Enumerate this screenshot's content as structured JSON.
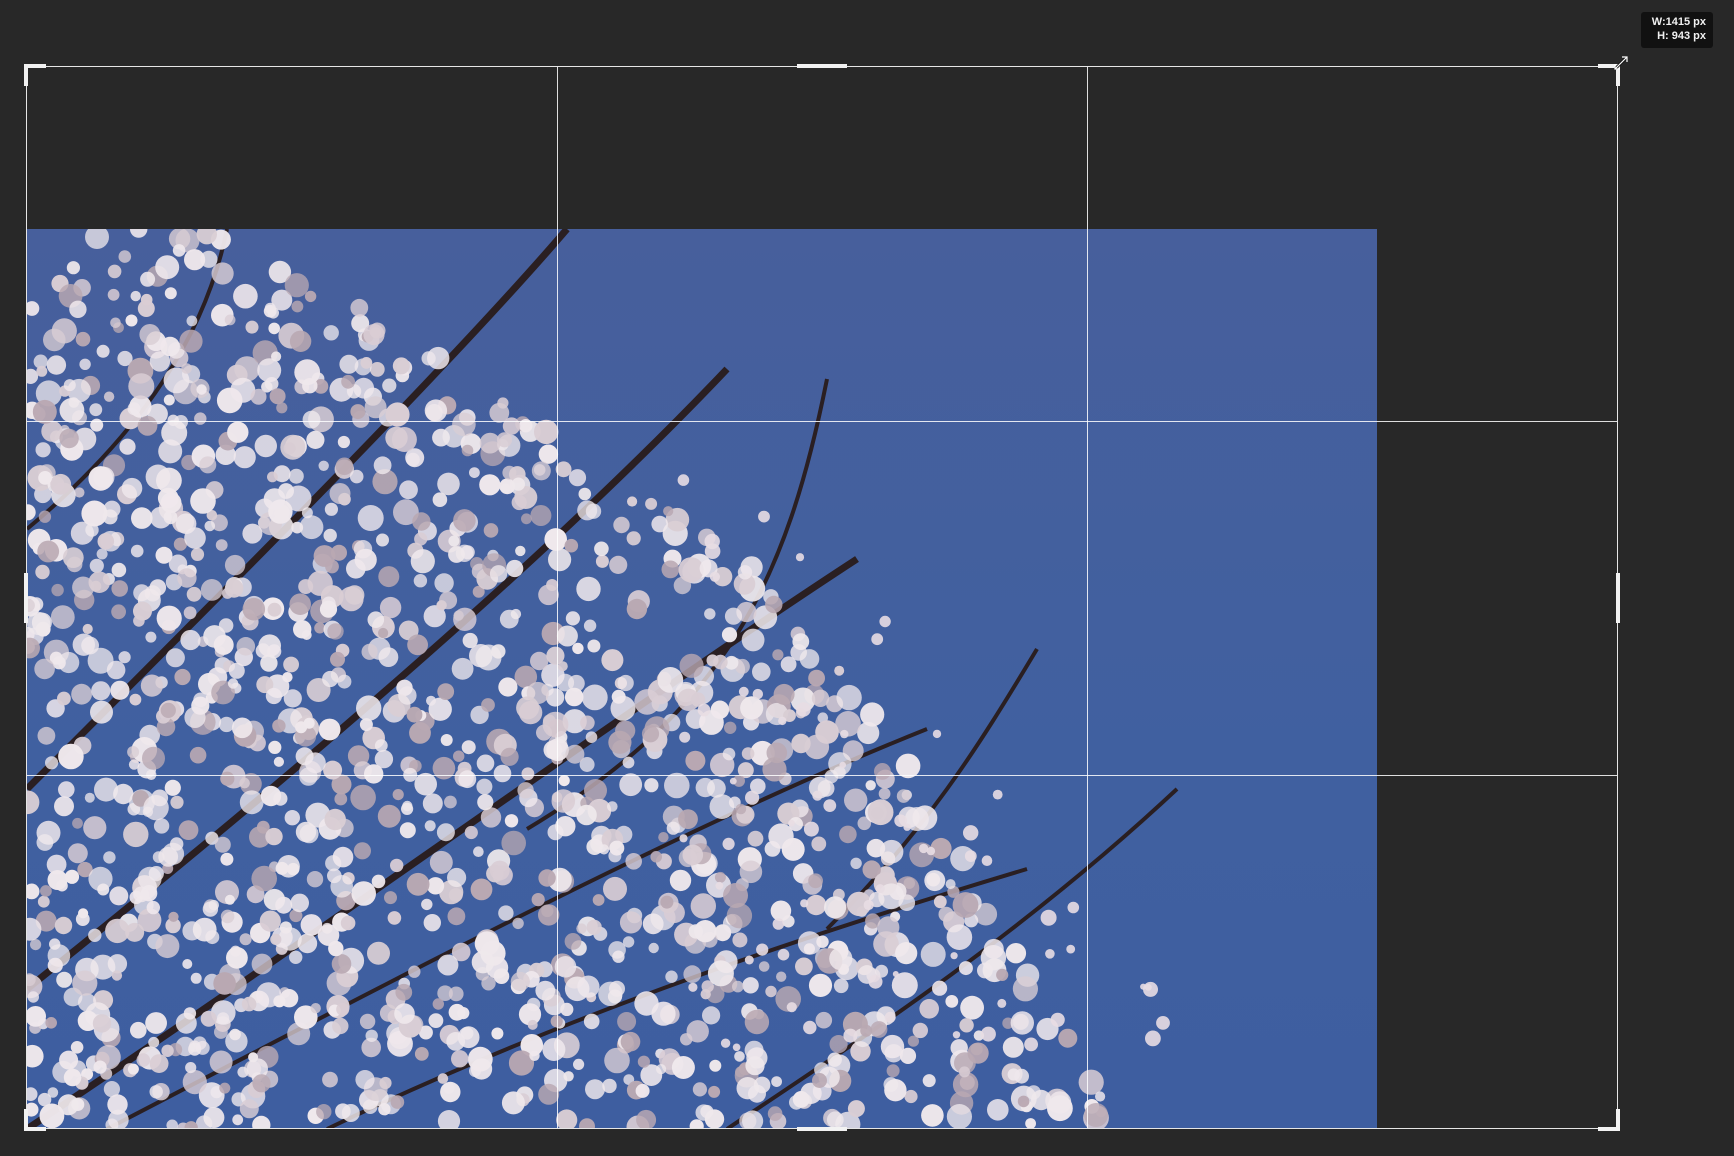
{
  "app": {
    "tool": "crop",
    "overlay": "rule-of-thirds"
  },
  "readout": {
    "width_label": "W:",
    "width_value": "1415 px",
    "height_label": "H:",
    "height_value": "943 px"
  },
  "colors": {
    "workspace_bg": "#282828",
    "sky": "#4560a0",
    "crop_frame": "#e6e6e6",
    "readout_bg": "#111111"
  },
  "icons": {
    "resize_cursor": "diagonal-resize-cursor-icon"
  }
}
